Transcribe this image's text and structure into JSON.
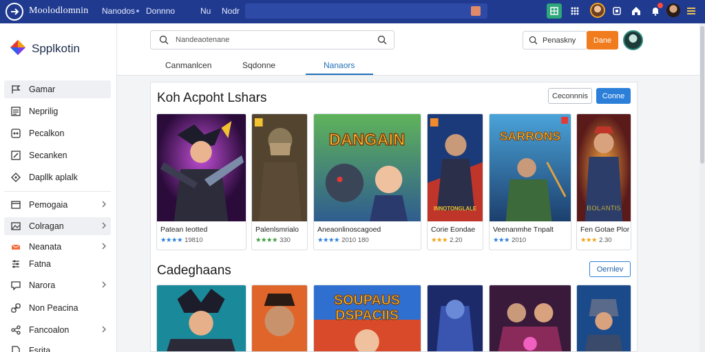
{
  "topbar": {
    "brand_part1": "Moolodlomnin",
    "nav": [
      "Nanodos",
      "Donnno",
      "Nu",
      "Nodr"
    ],
    "icons": [
      "grid-icon",
      "apps-icon",
      "square-icon",
      "home-icon",
      "notification-icon",
      "menu-icon"
    ]
  },
  "sidebar": {
    "brand": "Spplkotin",
    "items": [
      {
        "label": "Gamar",
        "icon": "flag-icon",
        "chevron": false,
        "active": true
      },
      {
        "label": "Neprilig",
        "icon": "list-icon",
        "chevron": false,
        "active": false
      },
      {
        "label": "Pecalkon",
        "icon": "controller-icon",
        "chevron": false,
        "active": false
      },
      {
        "label": "Secanken",
        "icon": "edit-icon",
        "chevron": false,
        "active": false
      },
      {
        "label": "Dapllk aplalk",
        "icon": "tag-icon",
        "chevron": false,
        "active": false
      },
      {
        "label": "Pemogaia",
        "icon": "card-icon",
        "chevron": true,
        "active": false
      },
      {
        "label": "Colragan",
        "icon": "image-icon",
        "chevron": true,
        "active": true
      },
      {
        "label": "Neanata",
        "icon": "mail-icon",
        "chevron": true,
        "active": false
      },
      {
        "label": "Fatna",
        "icon": "sliders-icon",
        "chevron": false,
        "active": false
      },
      {
        "label": "Narora",
        "icon": "chat-icon",
        "chevron": true,
        "active": false
      },
      {
        "label": "Non Peacina",
        "icon": "link-icon",
        "chevron": false,
        "active": false
      },
      {
        "label": "Fancoalon",
        "icon": "share-icon",
        "chevron": true,
        "active": false
      },
      {
        "label": "Fsrita",
        "icon": "document-icon",
        "chevron": false,
        "active": false
      }
    ]
  },
  "header": {
    "search_placeholder": "Nandeaotenane",
    "secondary_search": "Penaskny",
    "action_button": "Dane",
    "tabs": [
      {
        "label": "Canmanlcen",
        "active": false
      },
      {
        "label": "Sqdonne",
        "active": false
      },
      {
        "label": "Nanaors",
        "active": true
      }
    ]
  },
  "section1": {
    "title": "Koh Acpoht Lshars",
    "btn_outline": "Ceconnnis",
    "btn_primary": "Conne",
    "cards": [
      {
        "title": "Patean Ieotted",
        "stars": "★★★★",
        "rating": "19810",
        "star_color": "#2b7fd9"
      },
      {
        "title": "Palenlsmrialo",
        "stars": "★★★★",
        "rating": "330",
        "star_color": "#3a9a3a"
      },
      {
        "title": "Aneaonlinoscagoed",
        "stars": "★★★★",
        "rating": "2010 180",
        "star_color": "#2b7fd9"
      },
      {
        "title": "Corie Eondae",
        "stars": "★★★",
        "rating": "2.20",
        "star_color": "#f2a20f"
      },
      {
        "title": "Veenanmhe Tnpalt",
        "stars": "★★★",
        "rating": "2010",
        "star_color": "#2b7fd9"
      },
      {
        "title": "Fen Gotae Plor",
        "stars": "★★★",
        "rating": "2.30",
        "star_color": "#f2a20f"
      }
    ],
    "art_texts": [
      "DANGAIN",
      "SARRONS",
      "INNOTONGLALE",
      "BOLANTIS"
    ]
  },
  "section2": {
    "title": "Cadeghaans",
    "btn_outline": "Oernlev",
    "art_texts": [
      "SOUPAUS",
      "DSPACIIS"
    ]
  },
  "colors": {
    "topbar": "#1f3a8f",
    "accent_blue": "#2b7fd9",
    "accent_orange": "#f07c1d"
  }
}
